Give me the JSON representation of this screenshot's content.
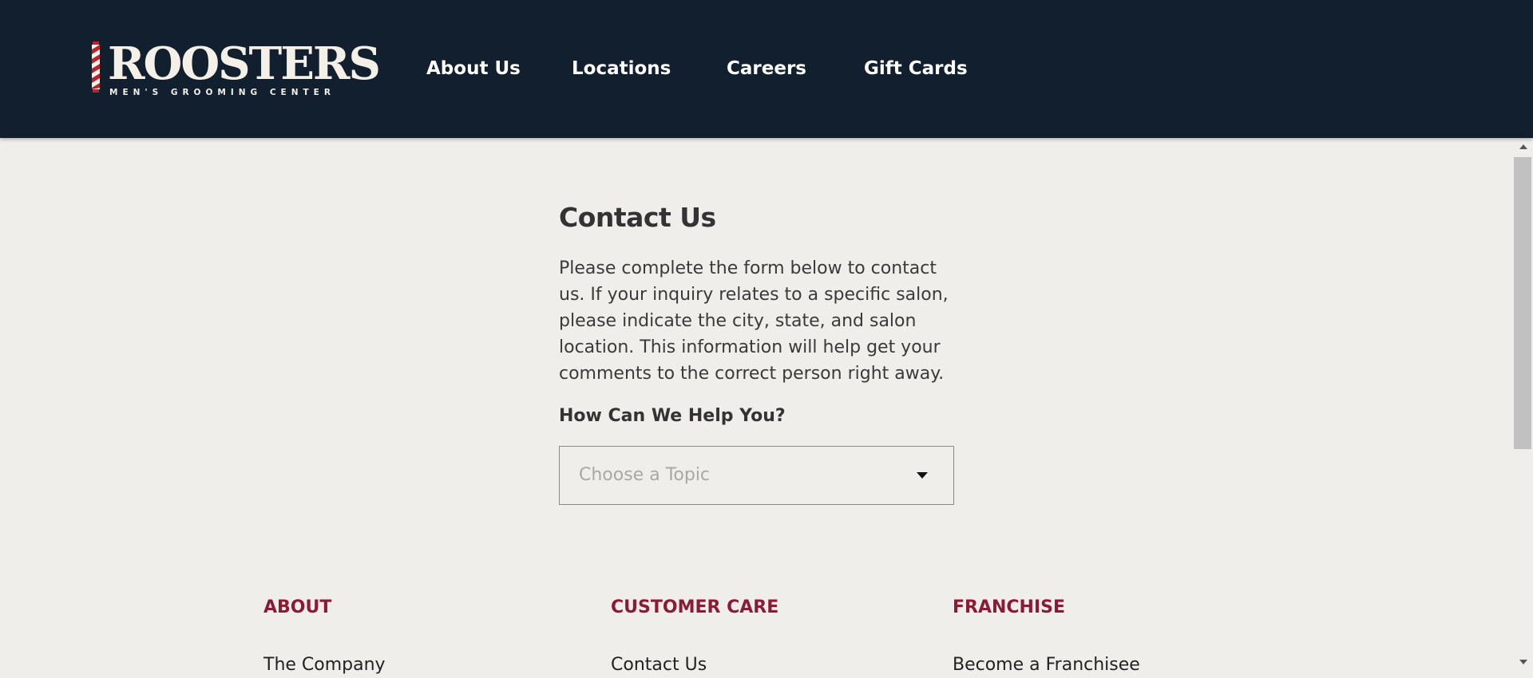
{
  "header": {
    "logo": {
      "wordmark": "ROOSTERS",
      "tagline": "MEN'S GROOMING CENTER",
      "pole_colors": [
        "#b3262c",
        "#f4f0e8"
      ]
    },
    "nav": [
      {
        "label": "About Us"
      },
      {
        "label": "Locations"
      },
      {
        "label": "Careers"
      },
      {
        "label": "Gift Cards"
      }
    ],
    "background": "#111f2e"
  },
  "main": {
    "title": "Contact Us",
    "intro": "Please complete the form below to contact us. If your inquiry relates to a specific salon, please indicate the city, state, and salon location. This information will help get your comments to the correct person right away.",
    "help_label": "How Can We Help You?",
    "topic_select": {
      "placeholder": "Choose a Topic",
      "icon": "chevron-down-icon"
    }
  },
  "footer": {
    "columns": [
      {
        "heading": "ABOUT",
        "first_link": "The Company"
      },
      {
        "heading": "CUSTOMER CARE",
        "first_link": "Contact Us"
      },
      {
        "heading": "FRANCHISE",
        "first_link": "Become a Franchisee"
      }
    ],
    "heading_color": "#8b1a34"
  }
}
